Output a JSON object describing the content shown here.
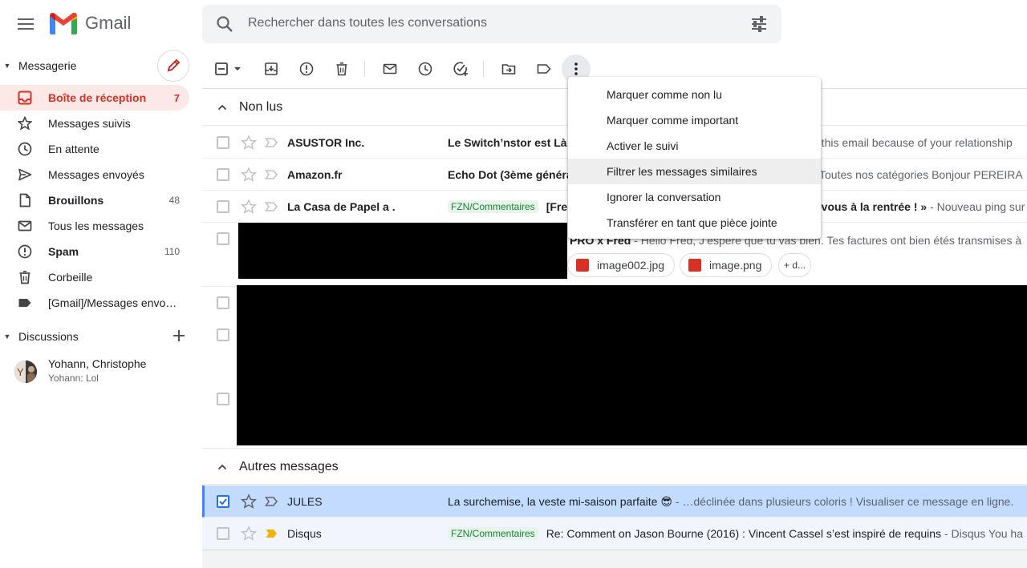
{
  "app": {
    "logo_text": "Gmail"
  },
  "search": {
    "placeholder": "Rechercher dans toutes les conversations"
  },
  "sidebar": {
    "mail_section": "Messagerie",
    "items": [
      {
        "label": "Boîte de réception",
        "count": "7",
        "icon": "inbox-icon"
      },
      {
        "label": "Messages suivis",
        "count": "",
        "icon": "star-icon"
      },
      {
        "label": "En attente",
        "count": "",
        "icon": "clock-icon"
      },
      {
        "label": "Messages envoyés",
        "count": "",
        "icon": "send-icon"
      },
      {
        "label": "Brouillons",
        "count": "48",
        "icon": "draft-icon"
      },
      {
        "label": "Tous les messages",
        "count": "",
        "icon": "mail-icon"
      },
      {
        "label": "Spam",
        "count": "110",
        "icon": "spam-icon"
      },
      {
        "label": "Corbeille",
        "count": "",
        "icon": "trash-icon"
      },
      {
        "label": "[Gmail]/Messages envo…",
        "count": "",
        "icon": "label-icon"
      }
    ],
    "chat_section": "Discussions",
    "chat": {
      "name": "Yohann, Christophe",
      "preview": "Yohann: Lol"
    }
  },
  "sections": {
    "unread": "Non lus",
    "others": "Autres messages"
  },
  "emails_unread": [
    {
      "sender": "ASUSTOR Inc.",
      "label": "",
      "subject": "Le Switch’nstor est Là!",
      "snippet": ""
    },
    {
      "sender": "Amazon.fr",
      "label": "",
      "subject": "Echo Dot (3ème généra",
      "snippet": ""
    },
    {
      "sender": "La Casa de Papel a .",
      "label": "FZN/Commentaires",
      "subject": "[Fre",
      "snippet": ""
    }
  ],
  "behind_menu": {
    "row1_tail": "g this email because of your relationship",
    "row2_tail": "Toutes nos catégories Bonjour PEREIRA",
    "row3_tail_bold": "z-vous à la rentrée ! »",
    "row3_tail_snip": " - Nouveau ping sur",
    "row4_sender": "PRO x Fred",
    "row4_snip": " - Hello Fred, J’espère que tu vas bien. Tes factures ont bien étés transmises à"
  },
  "attachments": [
    "image002.jpg",
    "image.png",
    "+ d..."
  ],
  "emails_other": [
    {
      "sender": "JULES",
      "label": "",
      "subject": "La surchemise, la veste mi-saison parfaite 😎",
      "snippet": " - …déclinée dans plusieurs coloris ! Visualiser ce message en ligne."
    },
    {
      "sender": "Disqus",
      "label": "FZN/Commentaires",
      "subject": "Re: Comment on Jason Bourne (2016) : Vincent Cassel s’est inspiré de requins",
      "snippet": " - Disqus You ha"
    }
  ],
  "menu": {
    "items": [
      "Marquer comme non lu",
      "Marquer comme important",
      "Activer le suivi",
      "Filtrer les messages similaires",
      "Ignorer la conversation",
      "Transférer en tant que pièce jointe"
    ]
  },
  "colors": {
    "accent_red": "#d93025",
    "selected_row": "#c2dbff",
    "label_green": "#188038"
  }
}
